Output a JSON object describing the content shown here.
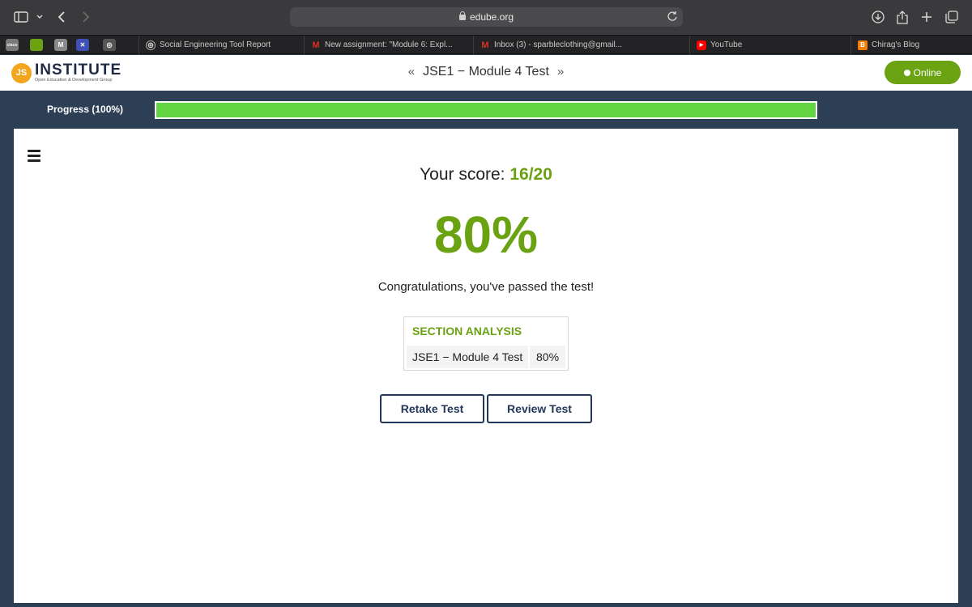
{
  "browser": {
    "url": "edube.org",
    "icons": {
      "sidebar": "sidebar-icon",
      "back": "back-arrow-icon",
      "forward": "forward-arrow-icon",
      "reload": "reload-icon",
      "download": "download-icon",
      "share": "share-icon",
      "new_tab": "plus-icon",
      "tab_overview": "tabs-overview-icon"
    },
    "pinned": [
      {
        "label": "cisco",
        "color": "#7a7a7a"
      },
      {
        "label": "",
        "color": "#6aa212"
      },
      {
        "label": "M",
        "color": "#8a8a8a"
      },
      {
        "label": "✕",
        "color": "#3f51b5"
      },
      {
        "label": "◎",
        "color": "#555555"
      }
    ],
    "tabs": [
      {
        "title": "Social Engineering Tool Report",
        "icon": "chatgpt-icon",
        "icon_color": "#555555"
      },
      {
        "title": "New assignment: \"Module 6: Expl...",
        "icon": "gmail-icon",
        "icon_color": "#d93025"
      },
      {
        "title": "Inbox (3) - sparbleclothing@gmail...",
        "icon": "gmail-icon",
        "icon_color": "#d93025"
      },
      {
        "title": "YouTube",
        "icon": "youtube-icon",
        "icon_color": "#ff0000"
      },
      {
        "title": "Chirag's Blog",
        "icon": "blogger-icon",
        "icon_color": "#f57d00"
      }
    ]
  },
  "header": {
    "logo_badge": "JS",
    "logo_main": "INSTITUTE",
    "logo_sub": "Open Education & Development Group",
    "title": "JSE1 − Module 4 Test",
    "prev_arrow": "«",
    "next_arrow": "»",
    "status": "Online"
  },
  "progress": {
    "label": "Progress (100%)",
    "value": 1.0,
    "color": "#63d442"
  },
  "result": {
    "score_label": "Your score:",
    "score_value": "16/20",
    "percent": "80%",
    "message": "Congratulations, you've passed the test!"
  },
  "analysis": {
    "title": "SECTION ANALYSIS",
    "rows": [
      {
        "name": "JSE1 − Module 4 Test",
        "value": "80%"
      }
    ]
  },
  "actions": {
    "retake": "Retake Test",
    "review": "Review Test"
  },
  "colors": {
    "accent": "#6aa212",
    "page_background": "#2d3f55",
    "button_border": "#22375a"
  }
}
